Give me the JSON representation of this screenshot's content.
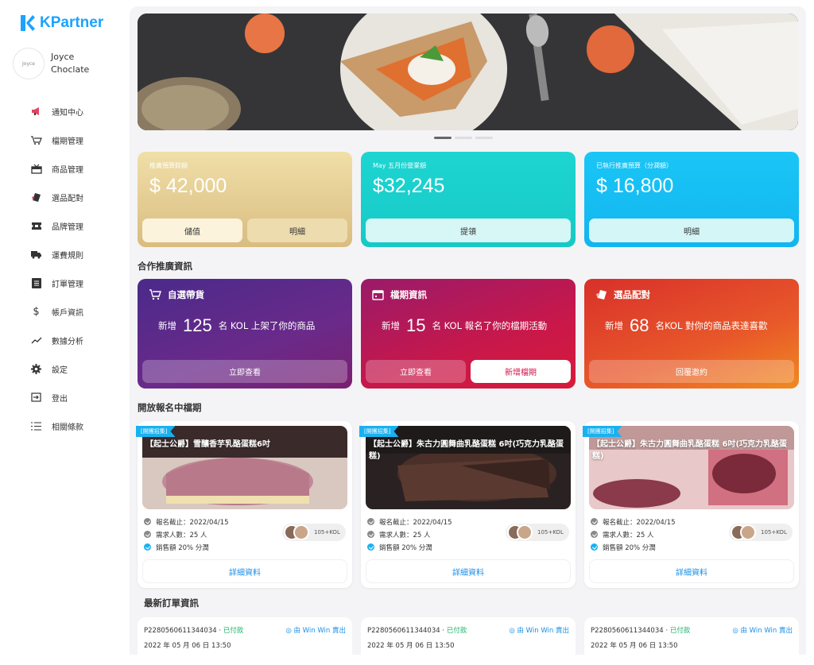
{
  "brand": {
    "name": "KPartner",
    "color": "#1aa3ff"
  },
  "profile": {
    "name": "Joyce Choclate",
    "avatar_text": "Joyce"
  },
  "nav": [
    {
      "label": "通知中心",
      "icon": "megaphone-icon"
    },
    {
      "label": "檔期管理",
      "icon": "cart-icon"
    },
    {
      "label": "商品管理",
      "icon": "gift-icon"
    },
    {
      "label": "選品配對",
      "icon": "tag-icon"
    },
    {
      "label": "品牌管理",
      "icon": "ticket-icon"
    },
    {
      "label": "運費規則",
      "icon": "truck-icon"
    },
    {
      "label": "訂單管理",
      "icon": "list-icon"
    },
    {
      "label": "帳戶資訊",
      "icon": "dollar-icon"
    },
    {
      "label": "數據分析",
      "icon": "trend-icon"
    },
    {
      "label": "設定",
      "icon": "gear-icon"
    },
    {
      "label": "登出",
      "icon": "logout-icon"
    },
    {
      "label": "相關條款",
      "icon": "terms-icon"
    }
  ],
  "stats": [
    {
      "label": "推廣預算餘額",
      "value": "$ 42,000",
      "buttons": [
        "儲值",
        "明細"
      ]
    },
    {
      "label": "May 五月份營業額",
      "value": "$32,245",
      "buttons": [
        "提領"
      ]
    },
    {
      "label": "已執行推廣預算（分潤額）",
      "value": "$ 16,800",
      "buttons": [
        "明細"
      ]
    }
  ],
  "coop_title": "合作推廣資訊",
  "coop": [
    {
      "title": "自選帶貨",
      "prefix": "新增",
      "num": "125",
      "suffix": "名 KOL 上架了你的商品",
      "buttons": [
        "立即查看"
      ]
    },
    {
      "title": "檔期資訊",
      "prefix": "新增",
      "num": "15",
      "suffix": "名 KOL 報名了你的檔期活動",
      "buttons": [
        "立即查看",
        "新增檔期"
      ]
    },
    {
      "title": "選品配對",
      "prefix": "新增",
      "num": "68",
      "suffix": "名KOL 對你的商品表達喜歡",
      "buttons": [
        "回覆邀約"
      ]
    }
  ],
  "campaign_title": "開放報名中檔期",
  "campaigns": [
    {
      "tag": "[開團招集]",
      "title": "【起士公爵】雪釀香芋乳酪蛋糕6吋",
      "deadline": "報名截止：2022/04/15",
      "people": "需求人數：25 人",
      "commission": "銷售額 20% 分潤",
      "kol": "105+KOL",
      "detail": "詳細資料"
    },
    {
      "tag": "[開團招集]",
      "title": "【起士公爵】朱古力圓舞曲乳酪蛋糕 6吋(巧克力乳酪蛋糕)",
      "deadline": "報名截止：2022/04/15",
      "people": "需求人數：25 人",
      "commission": "銷售額 20% 分潤",
      "kol": "105+KOL",
      "detail": "詳細資料"
    },
    {
      "tag": "[開團招集]",
      "title": "【起士公爵】朱古力圓舞曲乳酪蛋糕 6吋(巧克力乳酪蛋糕)",
      "deadline": "報名截止：2022/04/15",
      "people": "需求人數：25 人",
      "commission": "銷售額 20% 分潤",
      "kol": "105+KOL",
      "detail": "詳細資料"
    }
  ],
  "orders_title": "最新訂單資訊",
  "orders": [
    {
      "id": "P2280560611344034",
      "status": "已付款",
      "seller": "由 Win Win 賣出",
      "date": "2022 年 05 月 06 日 13:50"
    },
    {
      "id": "P2280560611344034",
      "status": "已付款",
      "seller": "由 Win Win 賣出",
      "date": "2022 年 05 月 06 日 13:50"
    },
    {
      "id": "P2280560611344034",
      "status": "已付款",
      "seller": "由 Win Win 賣出",
      "date": "2022 年 05 月 06 日 13:50"
    }
  ]
}
